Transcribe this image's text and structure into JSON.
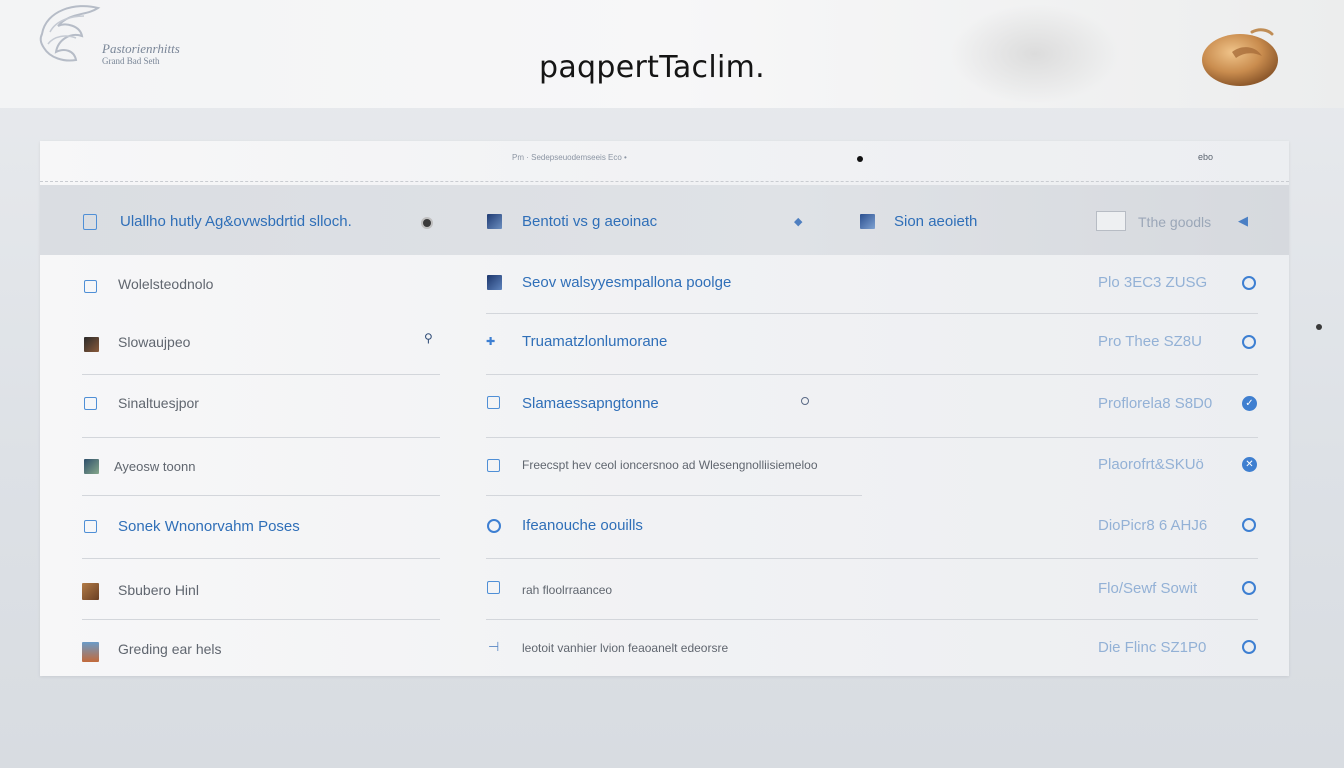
{
  "header": {
    "logo_line1": "Pastorienrhitts",
    "logo_line2": "Grand Bad Seth",
    "title": "paqpertTaclim."
  },
  "toolbar": {
    "crumb": "Pm · Sedepseuodemseeis Eco •",
    "menu": "ebo"
  },
  "table": {
    "header": {
      "col1": "Ulallho hutly Ag&ovwsbdrtid slloch.",
      "col2": "Bentoti vs g aeoinac",
      "col3": "Sion aeoieth",
      "col4": "Tthe goodls"
    },
    "rows": [
      {
        "left": "Wolelsteodnolo",
        "middle": "Seov walsyyesmpallona poolge",
        "right": "Plo 3EC3 ZUSG"
      },
      {
        "left": "Slowaujpeo",
        "middle": "Truamatzlonlumorane",
        "right": "Pro Thee SZ8U"
      },
      {
        "left": "Sinaltuesjpor",
        "middle": "Slamaessapngtonne",
        "right": "Proflorela8 S8D0"
      },
      {
        "left": "Ayeosw toonn",
        "middle": "Freecspt hev  ceol ioncersnoo ad Wlesengnolliisiemeloo",
        "right": "Plaorofrt&SKUö"
      },
      {
        "left": "Sonek Wnonorvahm Poses",
        "middle": "Ifeanouche oouills",
        "right": "DioPicr8 6 AHJ6"
      },
      {
        "left": "Sbubero Hinl",
        "middle": "rah floolrraanceo",
        "right": "Flo/Sewf Sowit"
      },
      {
        "left": "Greding ear hels",
        "middle": "leotoit vanhier lvion feaoanelt edeorsre",
        "right": "Die Flinc SZ1P0"
      }
    ]
  }
}
